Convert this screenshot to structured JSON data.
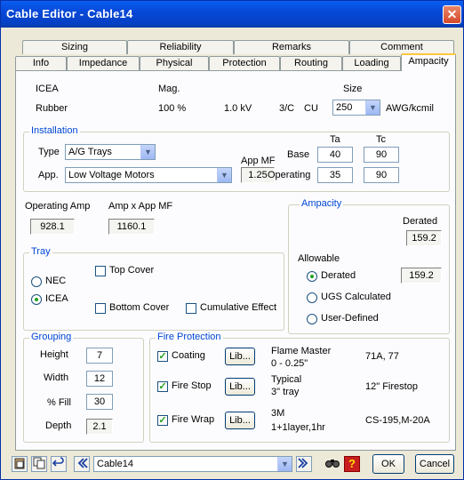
{
  "window": {
    "title": "Cable Editor - Cable14",
    "close_glyph": "✕"
  },
  "tabs_back": [
    "Sizing",
    "Reliability",
    "Remarks",
    "Comment"
  ],
  "tabs_front": [
    "Info",
    "Impedance",
    "Physical",
    "Protection",
    "Routing",
    "Loading",
    "Ampacity"
  ],
  "header": {
    "col1_top": "ICEA",
    "col1_bottom": "Rubber",
    "mag_label": "Mag.",
    "mag_value": "100 %",
    "kv": "1.0 kV",
    "cond": "3/C",
    "material": "CU",
    "size_label": "Size",
    "size_value": "250",
    "size_unit": "AWG/kcmil"
  },
  "installation": {
    "legend": "Installation",
    "type_label": "Type",
    "type_value": "A/G Trays",
    "app_label": "App.",
    "app_value": "Low Voltage Motors",
    "appmf_label": "App MF",
    "appmf_value": "1.25",
    "ta_label": "Ta",
    "tc_label": "Tc",
    "base_label": "Base",
    "base_ta": "40",
    "base_tc": "90",
    "oper_label": "Operating",
    "oper_ta": "35",
    "oper_tc": "90"
  },
  "amps": {
    "op_label": "Operating Amp",
    "op_value": "928.1",
    "mf_label": "Amp x App MF",
    "mf_value": "1160.1"
  },
  "ampacity": {
    "legend": "Ampacity",
    "derated_label": "Derated",
    "derated_value": "159.2",
    "allowable_label": "Allowable",
    "opt_derated": "Derated",
    "opt_derated_value": "159.2",
    "opt_ugs": "UGS Calculated",
    "opt_user": "User-Defined"
  },
  "tray": {
    "legend": "Tray",
    "nec": "NEC",
    "icea": "ICEA",
    "top_cover": "Top Cover",
    "bottom_cover": "Bottom Cover",
    "cumulative": "Cumulative Effect"
  },
  "grouping": {
    "legend": "Grouping",
    "height_label": "Height",
    "height_value": "7",
    "width_label": "Width",
    "width_value": "12",
    "fill_label": "% Fill",
    "fill_value": "30",
    "depth_label": "Depth",
    "depth_value": "2.1"
  },
  "fire": {
    "legend": "Fire Protection",
    "lib_label": "Lib...",
    "rows": [
      {
        "name": "Coating",
        "desc1": "Flame Master",
        "desc2": "0 - 0.25\"",
        "code": "71A, 77"
      },
      {
        "name": "Fire Stop",
        "desc1": "Typical",
        "desc2": "3\" tray",
        "code": "12\" Firestop"
      },
      {
        "name": "Fire Wrap",
        "desc1": "3M",
        "desc2": "1+1layer,1hr",
        "code": "CS-195,M-20A"
      }
    ]
  },
  "bottom": {
    "cable_value": "Cable14",
    "ok": "OK",
    "cancel": "Cancel",
    "icons": [
      "paste-icon",
      "copy-icon",
      "undo-icon",
      "back-icon",
      "forward-icon",
      "find-icon",
      "help-icon"
    ]
  },
  "colors": {
    "accent": "#0046d5",
    "title_bar": "#0748d8",
    "check": "#21a121"
  }
}
